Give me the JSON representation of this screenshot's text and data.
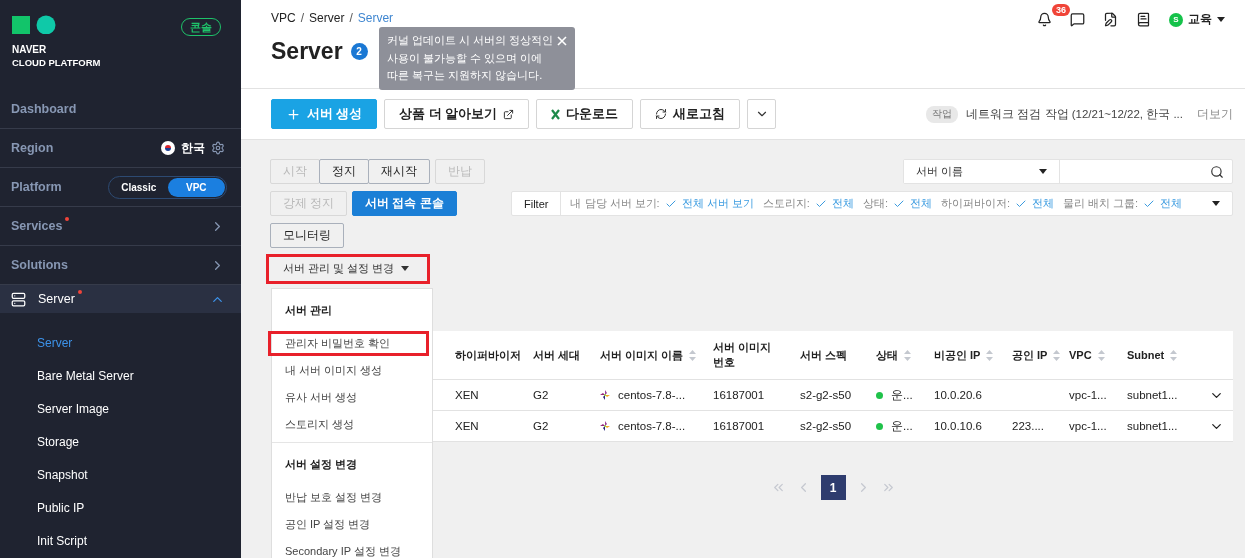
{
  "sidebar": {
    "logo": {
      "line1": "NAVER",
      "line2": "CLOUD PLATFORM"
    },
    "console_badge": "콘솔",
    "nav": [
      {
        "kind": "link",
        "label": "Dashboard"
      },
      {
        "kind": "region",
        "label": "Region",
        "value": "한국"
      },
      {
        "kind": "platform",
        "label": "Platform",
        "options": [
          {
            "label": "Classic",
            "selected": false
          },
          {
            "label": "VPC",
            "selected": true
          }
        ]
      },
      {
        "kind": "expand",
        "label": "Services",
        "notice": true
      },
      {
        "kind": "expand",
        "label": "Solutions"
      }
    ],
    "section": {
      "label": "Server",
      "notice": true,
      "expanded": true,
      "items": [
        {
          "label": "Server",
          "selected": true
        },
        {
          "label": "Bare Metal Server",
          "selected": false
        },
        {
          "label": "Server Image",
          "selected": false
        },
        {
          "label": "Storage",
          "selected": false
        },
        {
          "label": "Snapshot",
          "selected": false
        },
        {
          "label": "Public IP",
          "selected": false
        },
        {
          "label": "Init Script",
          "selected": false
        }
      ]
    }
  },
  "header": {
    "breadcrumb_separator": "/",
    "breadcrumb": [
      {
        "label": "VPC",
        "current": false
      },
      {
        "label": "Server",
        "current": false
      },
      {
        "label": "Server",
        "current": true
      }
    ],
    "title": "Server",
    "title_badge": "2",
    "tooltip": {
      "lines": [
        "커널 업데이트 시 서버의 정상적인",
        "사용이 불가능할 수 있으며 이에",
        "따른 복구는 지원하지 않습니다."
      ]
    },
    "notifications": "36",
    "user": {
      "initial": "S",
      "name": "교육"
    }
  },
  "toolbar": {
    "buttons": [
      {
        "kind": "primary",
        "label": "서버 생성"
      },
      {
        "kind": "external",
        "label": "상품 더 알아보기"
      },
      {
        "kind": "download",
        "label": "다운로드"
      },
      {
        "kind": "refresh",
        "label": "새로고침"
      }
    ],
    "notice": {
      "tag": "작업",
      "text": "네트워크 점검 작업 (12/21~12/22, 한국 ...",
      "more": "더보기"
    }
  },
  "actions": [
    {
      "groups": [
        [
          {
            "label": "시작",
            "disabled": true,
            "primary": false
          },
          {
            "label": "정지",
            "disabled": false,
            "primary": false
          },
          {
            "label": "재시작",
            "disabled": false,
            "primary": false
          }
        ],
        [
          {
            "label": "반납",
            "disabled": true,
            "primary": false
          }
        ]
      ]
    },
    {
      "groups": [
        [
          {
            "label": "강제 정지",
            "disabled": true,
            "primary": false
          }
        ],
        [
          {
            "label": "서버 접속 콘솔",
            "disabled": false,
            "primary": true
          }
        ]
      ]
    },
    {
      "groups": [
        [
          {
            "label": "모니터링",
            "disabled": false,
            "primary": false
          }
        ]
      ]
    }
  ],
  "search": {
    "field": "서버 이름"
  },
  "filter": {
    "label": "Filter",
    "items": [
      {
        "label": "내 담당 서버 보기:",
        "value": "전체 서버 보기"
      },
      {
        "label": "스토리지:",
        "value": "전체"
      },
      {
        "label": "상태:",
        "value": "전체"
      },
      {
        "label": "하이퍼바이저:",
        "value": "전체"
      },
      {
        "label": "물리 배치 그룹:",
        "value": "전체"
      }
    ]
  },
  "manage_dropdown": {
    "label": "서버 관리 및 설정 변경",
    "expanded": true,
    "highlighted": true
  },
  "menu": [
    {
      "title": "서버 관리",
      "items": [
        {
          "label": "관리자 비밀번호 확인",
          "highlighted": true
        },
        {
          "label": "내 서버 이미지 생성",
          "highlighted": false
        },
        {
          "label": "유사 서버 생성",
          "highlighted": false
        },
        {
          "label": "스토리지 생성",
          "highlighted": false
        }
      ]
    },
    {
      "title": "서버 설정 변경",
      "items": [
        {
          "label": "반납 보호 설정 변경",
          "highlighted": false
        },
        {
          "label": "공인 IP 설정 변경",
          "highlighted": false
        },
        {
          "label": "Secondary IP 설정 변경",
          "highlighted": false
        }
      ]
    }
  ],
  "table": {
    "columns": [
      {
        "label": "하이퍼바이저",
        "sortable": false
      },
      {
        "label": "서버 세대",
        "sortable": false
      },
      {
        "label": "서버 이미지 이름",
        "sortable": true
      },
      {
        "label": "서버 이미지\n번호",
        "sortable": false
      },
      {
        "label": "서버 스펙",
        "sortable": false
      },
      {
        "label": "상태",
        "sortable": true
      },
      {
        "label": "비공인 IP",
        "sortable": true
      },
      {
        "label": "공인 IP",
        "sortable": true
      },
      {
        "label": "VPC",
        "sortable": true
      },
      {
        "label": "Subnet",
        "sortable": true
      }
    ],
    "rows": [
      {
        "cells": [
          {
            "kind": "text",
            "text": "XEN"
          },
          {
            "kind": "text",
            "text": "G2"
          },
          {
            "kind": "image",
            "text": "centos-7.8-..."
          },
          {
            "kind": "text",
            "text": "16187001"
          },
          {
            "kind": "text",
            "text": "s2-g2-s50"
          },
          {
            "kind": "status",
            "text": "운...",
            "color": "#1fc24a"
          },
          {
            "kind": "text",
            "text": "10.0.20.6"
          },
          {
            "kind": "empty"
          },
          {
            "kind": "text",
            "text": "vpc-1..."
          },
          {
            "kind": "text",
            "text": "subnet1..."
          }
        ],
        "expanded": false
      },
      {
        "cells": [
          {
            "kind": "text",
            "text": "XEN"
          },
          {
            "kind": "text",
            "text": "G2"
          },
          {
            "kind": "image",
            "text": "centos-7.8-..."
          },
          {
            "kind": "text",
            "text": "16187001"
          },
          {
            "kind": "text",
            "text": "s2-g2-s50"
          },
          {
            "kind": "status",
            "text": "운...",
            "color": "#1fc24a"
          },
          {
            "kind": "text",
            "text": "10.0.10.6"
          },
          {
            "kind": "text",
            "text": "223...."
          },
          {
            "kind": "text",
            "text": "vpc-1..."
          },
          {
            "kind": "text",
            "text": "subnet1..."
          }
        ],
        "expanded": false
      }
    ]
  },
  "pagination": {
    "pages": [
      {
        "label": "1",
        "selected": true
      }
    ]
  }
}
